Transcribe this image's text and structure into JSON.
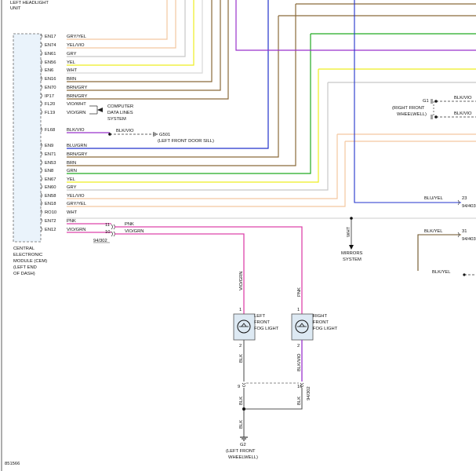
{
  "header": {
    "line1": "LEFT HEADLIGHT",
    "line2": "UNIT"
  },
  "cem": {
    "label_lines": [
      "CENTRAL",
      "ELECTRONIC",
      "MODULE (CEM)",
      "(LEFT END",
      "OF DASH)"
    ],
    "pins": [
      {
        "pin": "EN17",
        "wire": "GRY/YEL",
        "color": "#f3c7a0"
      },
      {
        "pin": "EN74",
        "wire": "YEL/VIO",
        "color": "#f3c7a0"
      },
      {
        "pin": "EN61",
        "wire": "GRY",
        "color": "#c8c8c8"
      },
      {
        "pin": "EN56",
        "wire": "YEL",
        "color": "#eeee22"
      },
      {
        "pin": "EN6",
        "wire": "WHT",
        "color": "#d8d8d8"
      },
      {
        "pin": "EN16",
        "wire": "BRN",
        "color": "#8a6a3a"
      },
      {
        "pin": "EN70",
        "wire": "BRN/GRY",
        "color": "#8a6a3a"
      },
      {
        "pin": "IP17",
        "wire": "BRN/GRY",
        "color": "#8a6a3a"
      },
      {
        "pin": "FL20",
        "wire": "VIO/WHT",
        "color": ""
      },
      {
        "pin": "FL19",
        "wire": "VIO/GRN",
        "color": ""
      },
      {
        "pin": "FL68",
        "wire": "BLK/VIO",
        "color": "#9933cc"
      },
      {
        "pin": "EN9",
        "wire": "BLU/GRN",
        "color": "#2233cc"
      },
      {
        "pin": "EN71",
        "wire": "BRN/GRY",
        "color": "#8a6a3a"
      },
      {
        "pin": "EN53",
        "wire": "BRN",
        "color": "#8a6a3a"
      },
      {
        "pin": "EN8",
        "wire": "GRN",
        "color": "#22aa22"
      },
      {
        "pin": "EN67",
        "wire": "YEL",
        "color": "#eeee22"
      },
      {
        "pin": "EN60",
        "wire": "GRY",
        "color": "#c8c8c8"
      },
      {
        "pin": "EN58",
        "wire": "YEL/VIO",
        "color": "#f3c7a0"
      },
      {
        "pin": "EN18",
        "wire": "GRY/YEL",
        "color": "#f3c7a0"
      },
      {
        "pin": "RO10",
        "wire": "WHT",
        "color": "#d8d8d8"
      },
      {
        "pin": "EN72",
        "wire": "PNK",
        "color": "#dd44aa"
      },
      {
        "pin": "EN12",
        "wire": "VIO/GRN",
        "color": "#dd44aa"
      }
    ]
  },
  "data_lines": {
    "line1": "COMPUTER",
    "line2": "DATA LINES",
    "line3": "SYSTEM"
  },
  "ground_g501": {
    "wire": "BLK/VIO",
    "id": "G501",
    "location": "(LEFT FRONT DOOR SILL)"
  },
  "ground_g1": {
    "id": "G1",
    "loc1": "(RIGHT FRONT",
    "loc2": "WHEELWELL)",
    "wire_top": "BLK/VIO",
    "wire_bottom": "BLK/VIO"
  },
  "connector_main": {
    "pin_pnk": "11",
    "pin_vio": "10",
    "wire_pnk": "PNK",
    "wire_vio": "VIO/GRN",
    "ref": "94/302"
  },
  "right_side": {
    "blu_yel": "BLU/YEL",
    "blu_yel_pin": "23",
    "blu_yel_ref": "94/403",
    "blk_yel": "BLK/YEL",
    "blk_yel_pin": "31",
    "blk_yel_ref": "94/403",
    "blk_yel2": "BLK/YEL"
  },
  "mirrors": {
    "wire": "WHT",
    "line1": "MIRRORS",
    "line2": "SYSTEM"
  },
  "left_fog": {
    "line1": "LEFT",
    "line2": "FRONT",
    "line3": "FOG LIGHT",
    "wire_in": "VIO/GRN",
    "wire_out": "BLK",
    "pin_in": "1",
    "pin_out": "2"
  },
  "right_fog": {
    "line1": "RIGHT",
    "line2": "FRONT",
    "line3": "FOG LIGHT",
    "wire_in": "PNK",
    "wire_out": "BLK/VIO",
    "pin_in": "1",
    "pin_out": "2"
  },
  "lower_connector": {
    "pin_left": "9",
    "pin_right": "16",
    "ref": "94/302",
    "wire_left": "BLK",
    "wire_right": "BLK",
    "wire_ground": "BLK"
  },
  "ground_g2": {
    "id": "G2",
    "loc1": "(LEFT FRONT",
    "loc2": "WHEELWELL)"
  },
  "footer": {
    "figure_id": "851566"
  }
}
